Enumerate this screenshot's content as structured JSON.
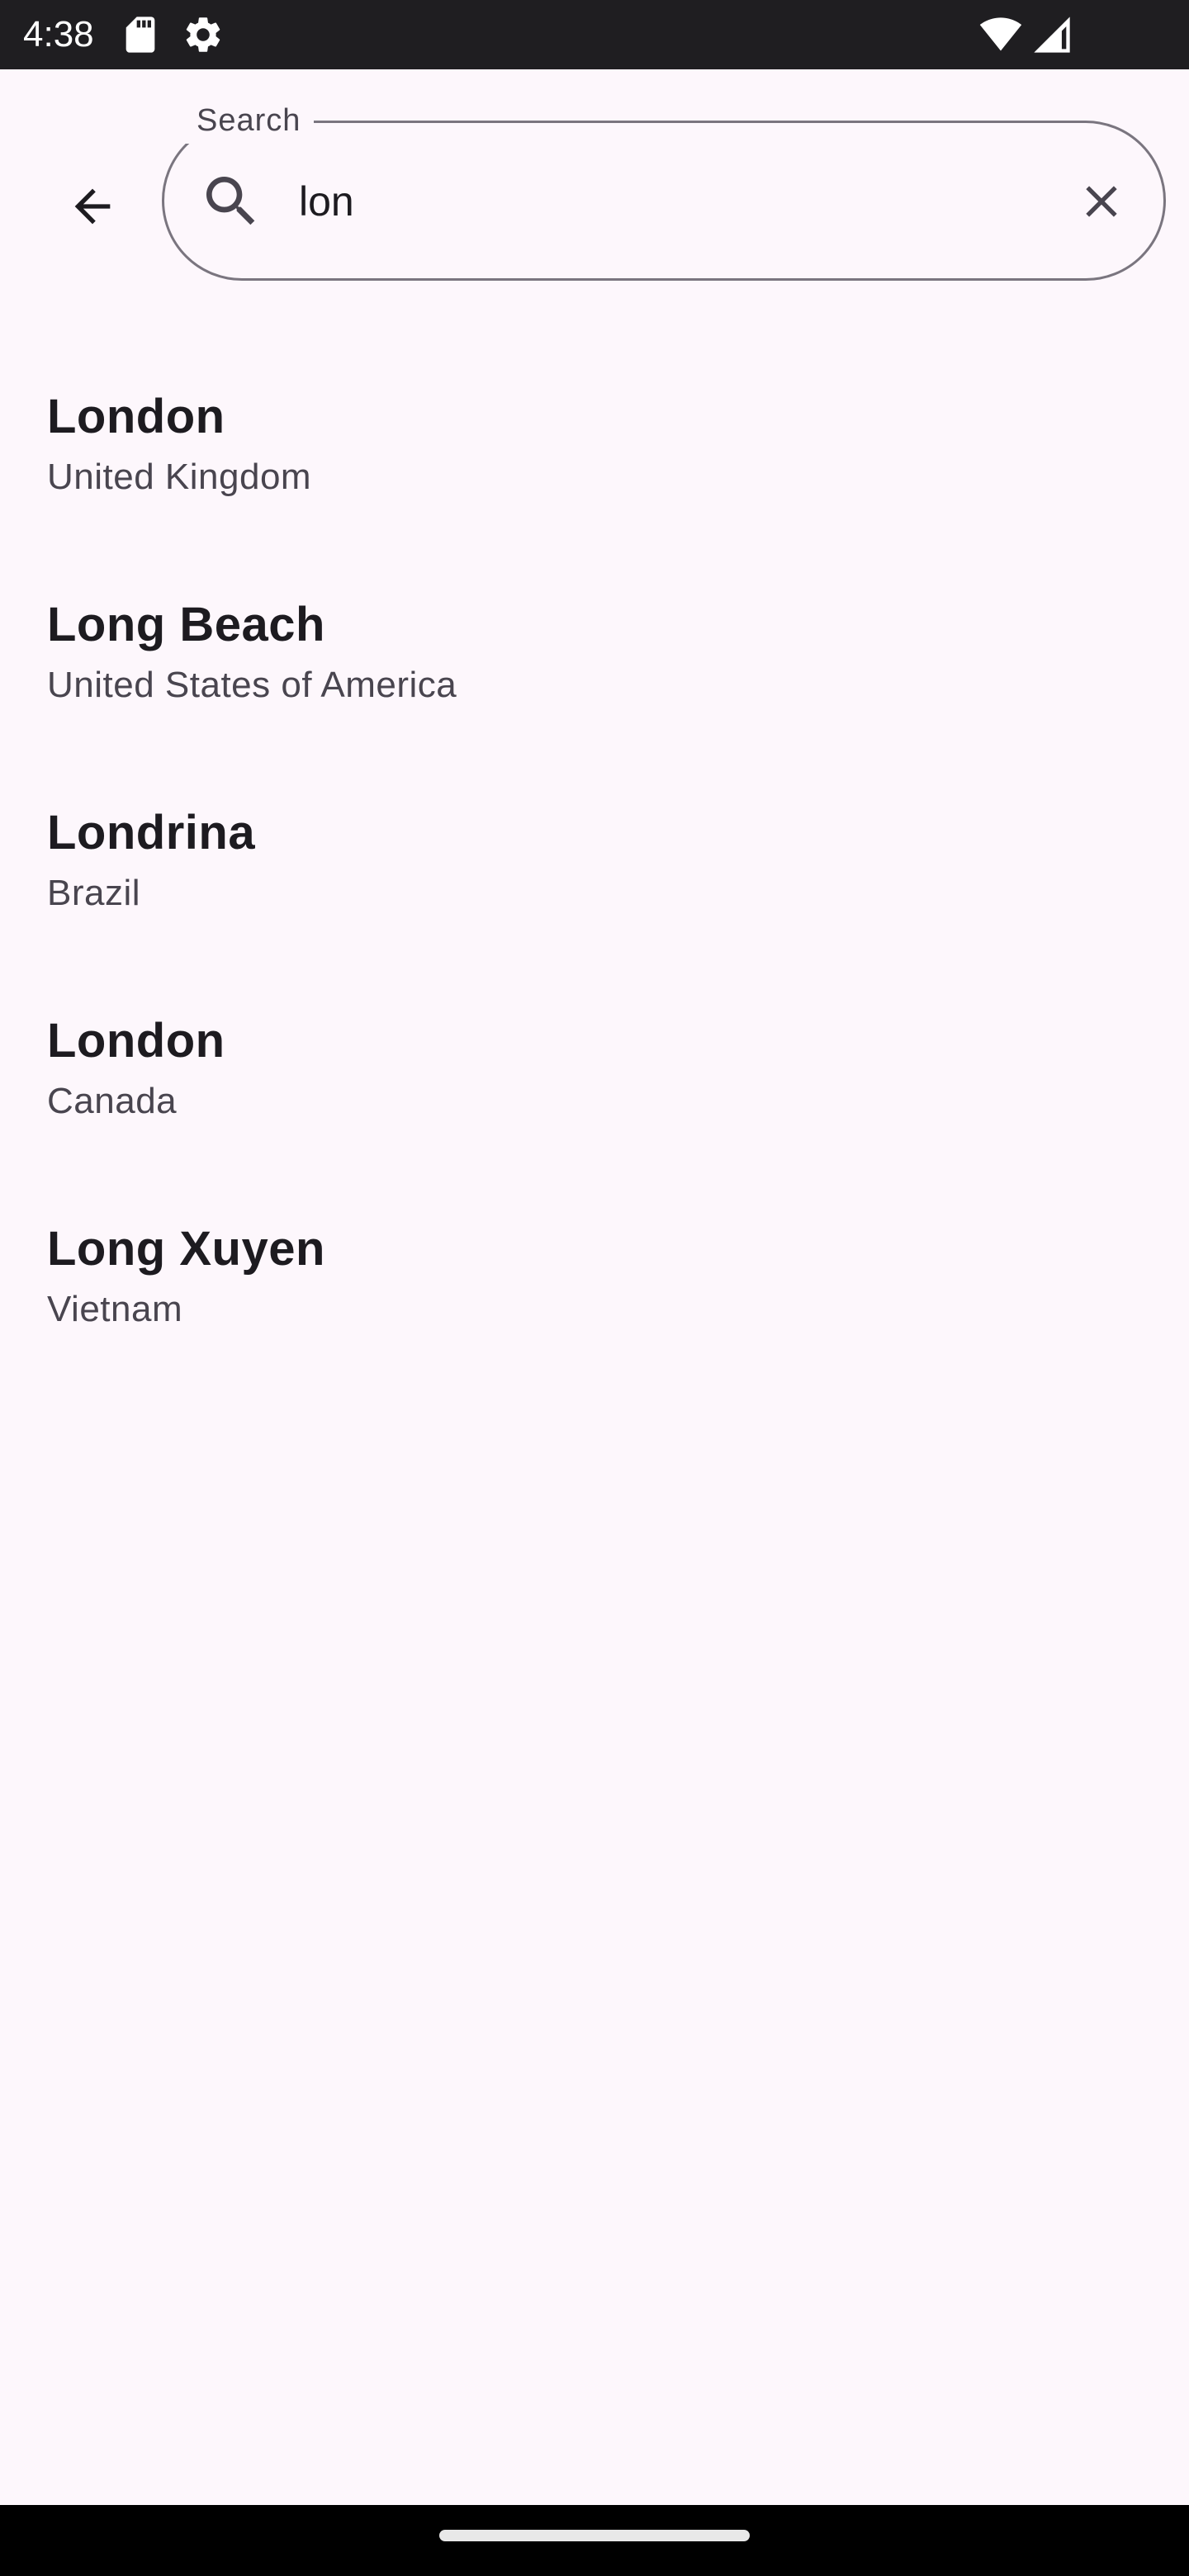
{
  "status_bar": {
    "time": "4:38",
    "icons": [
      "sd-card-icon",
      "settings-gear-icon",
      "wifi-icon",
      "cell-signal-icon"
    ]
  },
  "search": {
    "label": "Search",
    "value": "lon",
    "placeholder": ""
  },
  "results": [
    {
      "city": "London",
      "country": "United Kingdom"
    },
    {
      "city": "Long Beach",
      "country": "United States of America"
    },
    {
      "city": "Londrina",
      "country": "Brazil"
    },
    {
      "city": "London",
      "country": "Canada"
    },
    {
      "city": "Long Xuyen",
      "country": "Vietnam"
    }
  ],
  "colors": {
    "background": "#fdf7fc",
    "status_bar": "#1f1e21",
    "outline": "#7a757f",
    "on_surface": "#1d1b20",
    "on_surface_variant": "#49454f"
  }
}
